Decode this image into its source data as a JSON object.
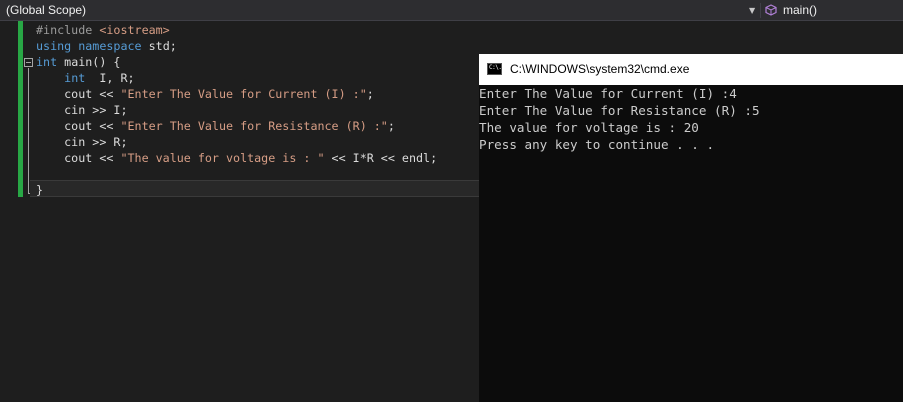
{
  "navbar": {
    "scope": "(Global Scope)",
    "member": "main()"
  },
  "editor": {
    "lines": [
      [
        {
          "t": "pp",
          "v": "#include "
        },
        {
          "t": "inc",
          "v": "<iostream>"
        }
      ],
      [
        {
          "t": "kw",
          "v": "using"
        },
        {
          "t": "plain",
          "v": " "
        },
        {
          "t": "kw",
          "v": "namespace"
        },
        {
          "t": "plain",
          "v": " std;"
        }
      ],
      [
        {
          "t": "kw",
          "v": "int"
        },
        {
          "t": "plain",
          "v": " main() {"
        }
      ],
      [
        {
          "t": "plain",
          "v": "    "
        },
        {
          "t": "kw",
          "v": "int"
        },
        {
          "t": "plain",
          "v": "  I, R;"
        }
      ],
      [
        {
          "t": "plain",
          "v": "    cout << "
        },
        {
          "t": "str",
          "v": "\"Enter The Value for Current (I) :\""
        },
        {
          "t": "plain",
          "v": ";"
        }
      ],
      [
        {
          "t": "plain",
          "v": "    cin >> I;"
        }
      ],
      [
        {
          "t": "plain",
          "v": "    cout << "
        },
        {
          "t": "str",
          "v": "\"Enter The Value for Resistance (R) :\""
        },
        {
          "t": "plain",
          "v": ";"
        }
      ],
      [
        {
          "t": "plain",
          "v": "    cin >> R;"
        }
      ],
      [
        {
          "t": "plain",
          "v": "    cout << "
        },
        {
          "t": "str",
          "v": "\"The value for voltage is : \""
        },
        {
          "t": "plain",
          "v": " << I*R << endl;"
        }
      ],
      [
        {
          "t": "plain",
          "v": ""
        }
      ],
      [
        {
          "t": "plain",
          "v": "}"
        }
      ]
    ]
  },
  "console": {
    "title": "C:\\WINDOWS\\system32\\cmd.exe",
    "icon_text": "C:\\.",
    "lines": [
      "Enter The Value for Current (I) :4",
      "Enter The Value for Resistance (R) :5",
      "The value for voltage is : 20",
      "Press any key to continue . . ."
    ]
  },
  "colors": {
    "keyword": "#569cd6",
    "string": "#d69d85",
    "preprocessor": "#9b9b9b",
    "change_indicator": "#28a745"
  },
  "icons": {
    "scope_dropdown": "chevron-down-icon",
    "member": "cube-icon",
    "console": "cmd-icon"
  }
}
